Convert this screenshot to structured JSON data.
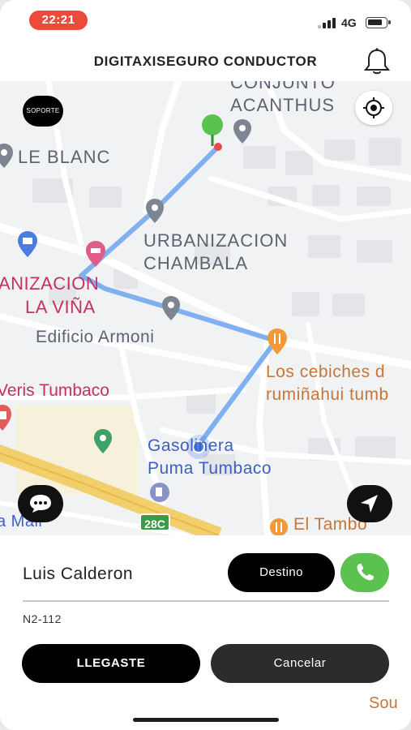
{
  "status_bar": {
    "time": "22:21",
    "network": "4G"
  },
  "header": {
    "title": "DIGITAXISEGURO CONDUCTOR"
  },
  "map": {
    "soporte_label": "SOPORTE",
    "labels": {
      "conjunto": "CONJUNTO",
      "acanthus": "ACANTHUS",
      "le_blanc": "LE BLANC",
      "urbanizacion": "URBANIZACION",
      "chambala": "CHAMBALA",
      "anizacion": "ANIZACION",
      "la_vina": "LA VIÑA",
      "edificio": "Edificio Armoni",
      "cebiches_1": "Los cebiches d",
      "cebiches_2": "rumiñahui tumb",
      "veris": "Veris Tumbaco",
      "gasolinera_1": "Gasolinera",
      "gasolinera_2": "Puma Tumbaco",
      "route_badge": "28C",
      "mall": "a Mall",
      "el_tambo": "El Tambo"
    }
  },
  "panel": {
    "driver_name": "Luis Calderon",
    "destino_label": "Destino",
    "plate": "N2-112",
    "llegaste_label": "LLEGASTE",
    "cancelar_label": "Cancelar",
    "peek_text": "Sou"
  },
  "colors": {
    "route": "#7fb0f0",
    "call_green": "#5bc24f",
    "start_pin": "#5bc24f",
    "time_pill": "#ec4a3c"
  }
}
